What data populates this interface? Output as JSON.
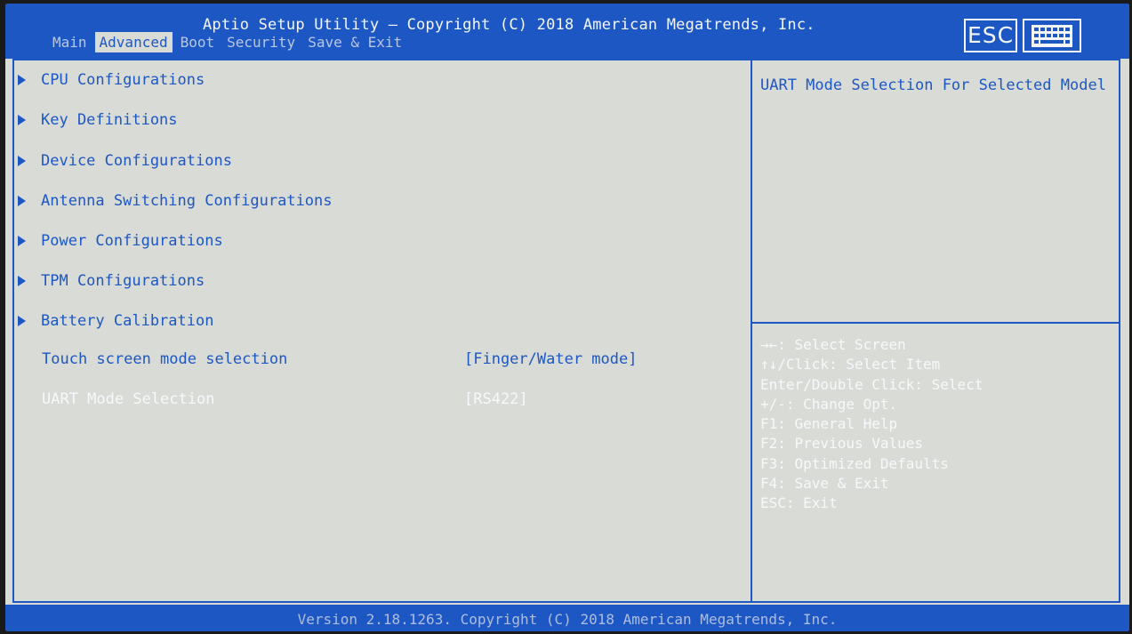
{
  "header": {
    "title": "Aptio Setup Utility – Copyright (C) 2018 American Megatrends, Inc.",
    "tabs": [
      {
        "label": "Main"
      },
      {
        "label": "Advanced"
      },
      {
        "label": "Boot"
      },
      {
        "label": "Security"
      },
      {
        "label": "Save & Exit"
      }
    ],
    "active_tab": "Advanced",
    "esc_label": "ESC",
    "keyboard_icon": "keyboard-icon"
  },
  "menu": {
    "submenus": [
      {
        "label": "CPU Configurations"
      },
      {
        "label": "Key Definitions"
      },
      {
        "label": "Device Configurations"
      },
      {
        "label": "Antenna Switching Configurations"
      },
      {
        "label": "Power Configurations"
      },
      {
        "label": "TPM Configurations"
      },
      {
        "label": "Battery Calibration"
      }
    ],
    "settings": [
      {
        "label": "Touch screen mode selection",
        "value": "[Finger/Water mode]",
        "selected": false
      },
      {
        "label": "UART Mode Selection",
        "value": "[RS422]",
        "selected": true
      }
    ]
  },
  "help": {
    "description": "UART Mode Selection For Selected Model",
    "keys": [
      "→←: Select Screen",
      "↑↓/Click: Select Item",
      "Enter/Double Click: Select",
      "+/-: Change Opt.",
      "F1: General Help",
      "F2: Previous Values",
      "F3: Optimized Defaults",
      "F4: Save & Exit",
      "ESC: Exit"
    ]
  },
  "footer": {
    "version": "Version 2.18.1263. Copyright (C) 2018 American Megatrends, Inc."
  },
  "colors": {
    "accent_blue": "#1d57c4",
    "panel_bg": "#d9dbd6",
    "highlight_text": "#f7f8fb"
  }
}
